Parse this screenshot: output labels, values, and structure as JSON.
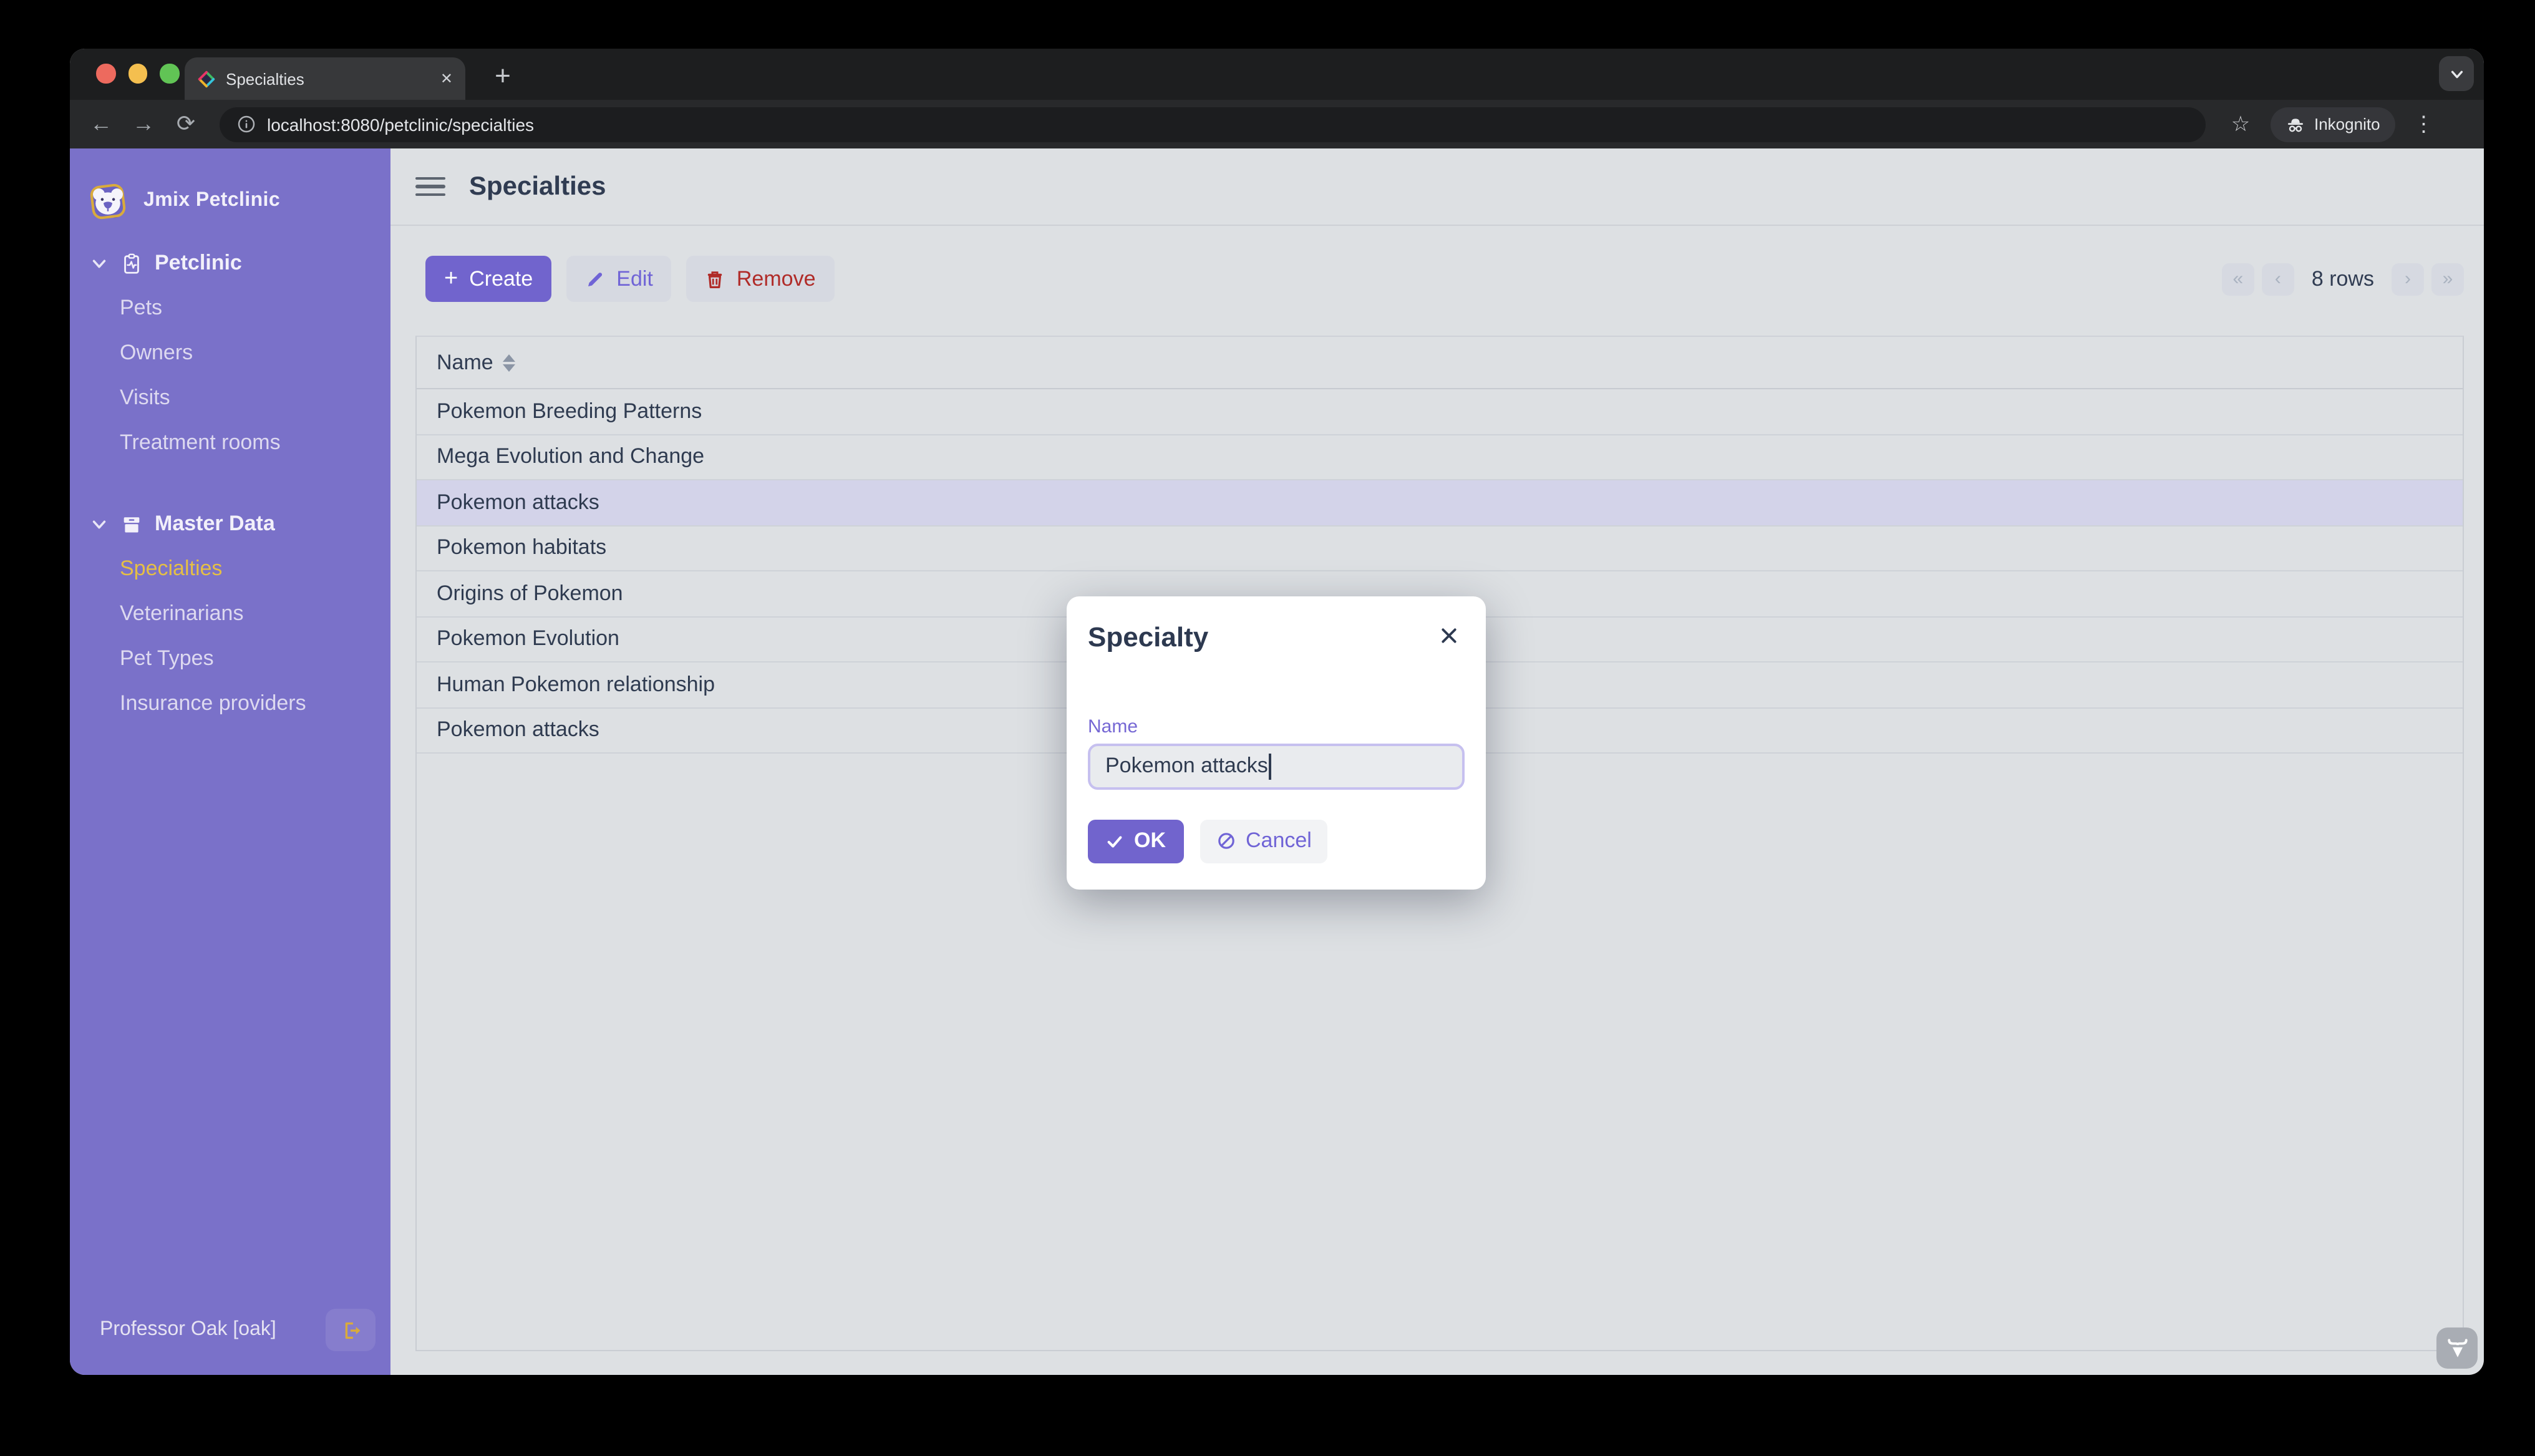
{
  "browser": {
    "tab_title": "Specialties",
    "url": "localhost:8080/petclinic/specialties",
    "incognito_label": "Inkognito"
  },
  "icons": {
    "back": "←",
    "forward": "→",
    "reload": "⟳",
    "star": "☆",
    "kebab": "⋮",
    "new_tab": "+",
    "tab_close": "✕"
  },
  "sidebar": {
    "app_title": "Jmix Petclinic",
    "sections": [
      {
        "label": "Petclinic",
        "items": [
          {
            "label": "Pets"
          },
          {
            "label": "Owners"
          },
          {
            "label": "Visits"
          },
          {
            "label": "Treatment rooms"
          }
        ]
      },
      {
        "label": "Master Data",
        "items": [
          {
            "label": "Specialties"
          },
          {
            "label": "Veterinarians"
          },
          {
            "label": "Pet Types"
          },
          {
            "label": "Insurance providers"
          }
        ]
      }
    ],
    "user_label": "Professor Oak [oak]"
  },
  "main": {
    "title": "Specialties",
    "actions": {
      "create": "Create",
      "edit": "Edit",
      "remove": "Remove"
    },
    "pagination": {
      "first": "«",
      "prev": "‹",
      "rows_label": "8 rows",
      "next": "›",
      "last": "»"
    },
    "table": {
      "column": "Name",
      "rows": [
        {
          "name": "Pokemon Breeding Patterns"
        },
        {
          "name": "Mega Evolution and Change"
        },
        {
          "name": "Pokemon attacks"
        },
        {
          "name": "Pokemon habitats"
        },
        {
          "name": "Origins of Pokemon"
        },
        {
          "name": "Pokemon Evolution"
        },
        {
          "name": "Human Pokemon relationship"
        },
        {
          "name": "Pokemon attacks"
        }
      ],
      "selected_row_index": 2
    }
  },
  "dialog": {
    "title": "Specialty",
    "name_label": "Name",
    "name_value": "Pokemon attacks",
    "ok_label": "OK",
    "cancel_label": "Cancel"
  },
  "colors": {
    "sidebar_purple": "#7a71c9",
    "primary_purple": "#7164cd",
    "active_item_yellow": "#e5bf45",
    "danger_red": "#b02b28",
    "content_bg": "#dde0e3",
    "selected_row": "#d3d3e9",
    "text_navy": "#303c52"
  }
}
